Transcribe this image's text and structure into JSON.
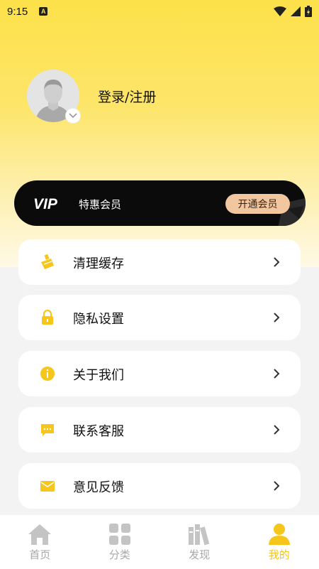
{
  "status_bar": {
    "time": "9:15",
    "notification_badge": "A"
  },
  "profile": {
    "login_label": "登录/注册"
  },
  "vip": {
    "logo": "VIP",
    "subtitle": "特惠会员",
    "button_label": "开通会员"
  },
  "menu": [
    {
      "label": "清理缓存",
      "icon": "broom-icon"
    },
    {
      "label": "隐私设置",
      "icon": "lock-icon"
    },
    {
      "label": "关于我们",
      "icon": "info-icon"
    },
    {
      "label": "联系客服",
      "icon": "chat-icon"
    },
    {
      "label": "意见反馈",
      "icon": "mail-icon"
    }
  ],
  "tabs": [
    {
      "label": "首页",
      "icon": "home-icon",
      "active": false
    },
    {
      "label": "分类",
      "icon": "grid-icon",
      "active": false
    },
    {
      "label": "发现",
      "icon": "books-icon",
      "active": false
    },
    {
      "label": "我的",
      "icon": "person-icon",
      "active": true
    }
  ],
  "colors": {
    "accent": "#f7c61a",
    "tab_inactive": "#a8a8a8",
    "vip_button": "#f2c7a0",
    "vip_card": "#0b0b0b"
  }
}
